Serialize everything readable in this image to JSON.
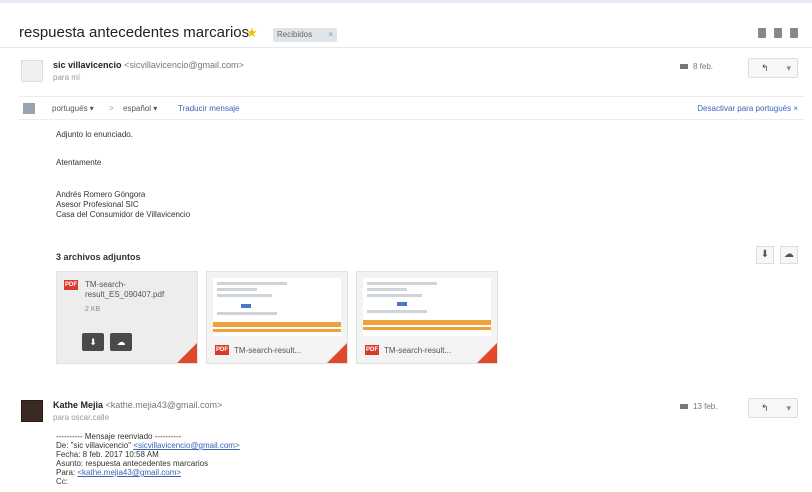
{
  "thread": {
    "subject": "respuesta antecedentes marcarios",
    "label": "Recibidos",
    "label_close": "×"
  },
  "message1": {
    "sender_name": "sic villavicencio",
    "sender_email": "<sicvillavicencio@gmail.com>",
    "to": "para mí",
    "time": "8 feb.",
    "reply_label": "↰",
    "translate": {
      "from_lang": "portugués ▾",
      "arrow": ">",
      "to_lang": "español ▾",
      "translate_link": "Traducir mensaje",
      "disable_link": "Desactivar para portugués ×"
    },
    "body": {
      "line1": "Adjunto lo enunciado.",
      "line2": "Atentamente",
      "sig1": "Andrés Romero Góngora",
      "sig2": "Asesor Profesional SIC",
      "sig3": "Casa del Consumidor de Villavicencio"
    },
    "attachments_title": "3 archivos adjuntos",
    "attachments": [
      {
        "name": "TM-search-result_ES_090407.pdf",
        "size": "2 KB"
      },
      {
        "name": "TM-search-result..."
      },
      {
        "name": "TM-search-result..."
      }
    ]
  },
  "message2": {
    "sender_name": "Kathe Mejia",
    "sender_email": "<kathe.mejia43@gmail.com>",
    "to": "para oscar.calle",
    "time": "13 feb.",
    "reply_label": "↰",
    "fwd": {
      "header": "---------- Mensaje reenviado ----------",
      "de_label": "De: \"sic villavicencio\" ",
      "de_email": "<sicvillavicencio@gmail.com>",
      "fecha": "Fecha: 8 feb. 2017 10:58 AM",
      "asunto": "Asunto: respuesta antecedentes marcarios",
      "para_label": "Para: ",
      "para_email": "<kathe.mejia43@gmail.com>",
      "cc": "Cc:"
    }
  },
  "icons": {
    "star": "★",
    "download": "⬇",
    "drive": "☁",
    "pdf": "PDF"
  }
}
